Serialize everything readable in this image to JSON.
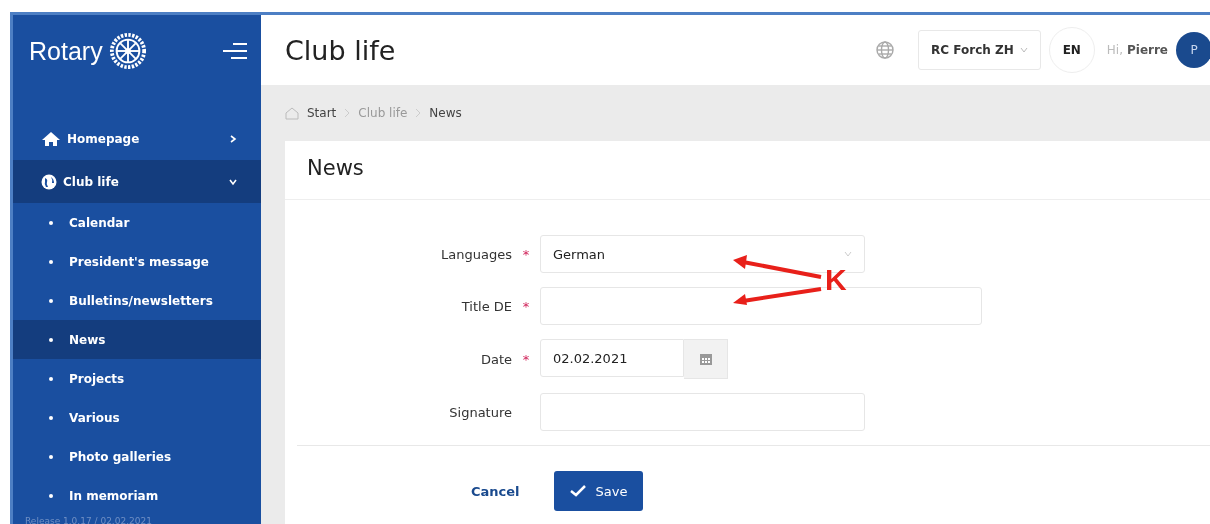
{
  "sidebar": {
    "logo": "Rotary",
    "items": [
      {
        "label": "Homepage",
        "selected": false,
        "expanded": false
      },
      {
        "label": "Club life",
        "selected": true,
        "expanded": true,
        "children": [
          {
            "label": "Calendar",
            "selected": false
          },
          {
            "label": "President's message",
            "selected": false
          },
          {
            "label": "Bulletins/newsletters",
            "selected": false
          },
          {
            "label": "News",
            "selected": true
          },
          {
            "label": "Projects",
            "selected": false
          },
          {
            "label": "Various",
            "selected": false
          },
          {
            "label": "Photo galleries",
            "selected": false
          },
          {
            "label": "In memoriam",
            "selected": false
          }
        ]
      }
    ],
    "release": "Release 1.0.17 / 02.02.2021"
  },
  "header": {
    "title": "Club life",
    "club": "RC Forch ZH",
    "language": "EN",
    "greeting": "Hi,",
    "user": "Pierre",
    "avatar": "P"
  },
  "breadcrumb": [
    "Start",
    "Club life",
    "News"
  ],
  "card": {
    "title": "News",
    "fields": [
      {
        "kind": "select",
        "label": "Languages",
        "required_mark": "*",
        "value": "German"
      },
      {
        "kind": "text",
        "label": "Title DE",
        "required_mark": "*"
      },
      {
        "kind": "date",
        "label": "Date",
        "required_mark": "*",
        "value": "02.02.2021"
      },
      {
        "kind": "text",
        "label": "Signature"
      }
    ],
    "cancel": "Cancel",
    "save": "Save"
  },
  "annotation": {
    "text": "K"
  }
}
